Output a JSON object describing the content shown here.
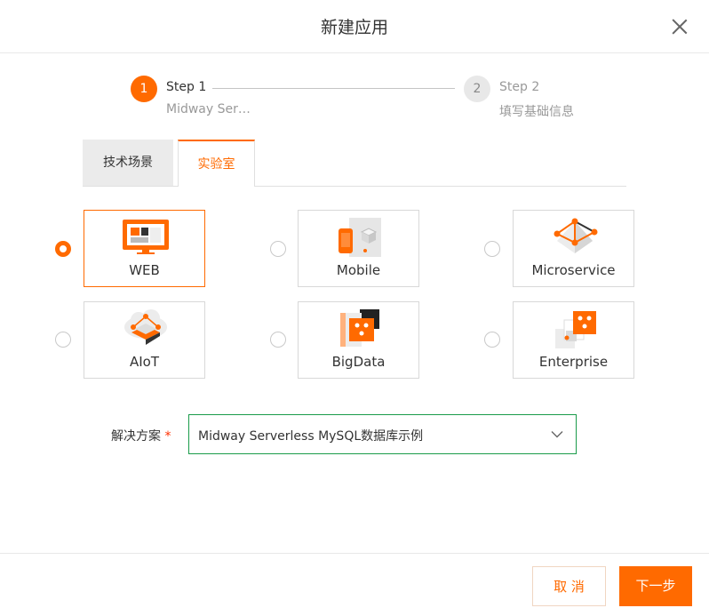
{
  "dialog": {
    "title": "新建应用"
  },
  "steps": [
    {
      "number": "1",
      "title": "Step 1",
      "description": "Midway Ser…",
      "state": "active"
    },
    {
      "number": "2",
      "title": "Step 2",
      "description": "填写基础信息",
      "state": "pending"
    }
  ],
  "tabs": [
    {
      "label": "技术场景",
      "active": false
    },
    {
      "label": "实验室",
      "active": true
    }
  ],
  "scenarios": [
    {
      "label": "WEB",
      "icon": "monitor-icon",
      "selected": true
    },
    {
      "label": "Mobile",
      "icon": "mobile-icon",
      "selected": false
    },
    {
      "label": "Microservice",
      "icon": "microservice-icon",
      "selected": false
    },
    {
      "label": "AIoT",
      "icon": "aiot-cloud-icon",
      "selected": false
    },
    {
      "label": "BigData",
      "icon": "bigdata-icon",
      "selected": false
    },
    {
      "label": "Enterprise",
      "icon": "enterprise-icon",
      "selected": false
    }
  ],
  "solution": {
    "label": "解决方案",
    "required_mark": "*",
    "value": "Midway Serverless MySQL数据库示例"
  },
  "footer": {
    "cancel_label": "取 消",
    "next_label": "下一步"
  },
  "colors": {
    "accent": "#ff6a00",
    "select_border": "#1a9b4a"
  }
}
